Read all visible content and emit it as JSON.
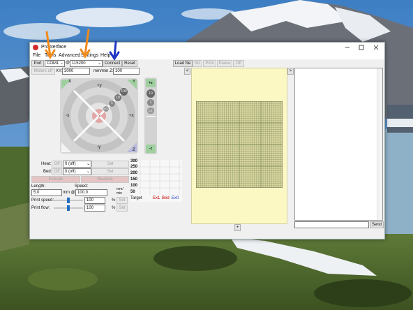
{
  "window": {
    "title": "Pronterface"
  },
  "menu": {
    "file": "File",
    "tools": "Tools",
    "advanced": "Advanced",
    "settings": "Settings",
    "help": "Help"
  },
  "connection": {
    "port_label": "Port",
    "port_value": "COM1",
    "at_symbol": "@",
    "baud_value": "115200",
    "connect_label": "Connect",
    "reset_label": "Reset"
  },
  "toolbar_right": {
    "load_file": "Load file",
    "sd": "SD",
    "print": "Print",
    "pause": "Pause",
    "off": "Off"
  },
  "motion": {
    "motors_off": "Motors off",
    "xy_label": "XY:",
    "xy_speed": "3000",
    "z_units_label": "mm/min Z:",
    "z_speed": "100",
    "jog_top": "+y",
    "jog_bottom": "-y",
    "jog_left": "-x",
    "jog_right": "+x",
    "home_xy": "X",
    "home_x": "X",
    "home_y": "Y",
    "home_z": "Z",
    "step_100": "100",
    "step_10": "10",
    "step_1": "1",
    "step_01": "0.1",
    "z_top": "+z",
    "z_bottom": "-z",
    "z_steps": [
      "10",
      "1",
      "0.1"
    ]
  },
  "temps": {
    "heat_label": "Heat:",
    "bed_label": "Bed:",
    "off_label": "Off",
    "heat_value": "0 (off)",
    "bed_value": "0 (off)",
    "set_label": "Set"
  },
  "extrude": {
    "extrude_label": "Extrude",
    "reverse_label": "Reverse",
    "length_label": "Length:",
    "speed_label": "Speed:",
    "length_value": "5.0",
    "mm_at": "mm @",
    "speed_value": "100.0",
    "speed_units": "mm/\nmin"
  },
  "factors": {
    "print_speed_label": "Print speed:",
    "print_speed_value": "100",
    "print_flow_label": "Print flow:",
    "print_flow_value": "100",
    "percent": "%",
    "set_label": "Set",
    "print_speed_fraction": 0.5,
    "print_flow_fraction": 0.5
  },
  "temp_graph": {
    "ticks": [
      "300",
      "250",
      "200",
      "150",
      "100",
      "50"
    ],
    "legend": [
      "Target",
      "Ex1",
      "Bed",
      "Ex0"
    ],
    "legend_colors": [
      "#000000",
      "#cc0000",
      "#cc0000",
      "#2244cc"
    ]
  },
  "console": {
    "send_label": "Send",
    "input_value": ""
  },
  "nav": {
    "prev": "<",
    "next": ">",
    "plus": "+"
  },
  "colors": {
    "plate": "#fbf8c4",
    "grid": "#7d8a5a",
    "accent_orange": "#f08a1c",
    "accent_blue": "#1f35c4",
    "jog_green": "#5aa05a"
  }
}
